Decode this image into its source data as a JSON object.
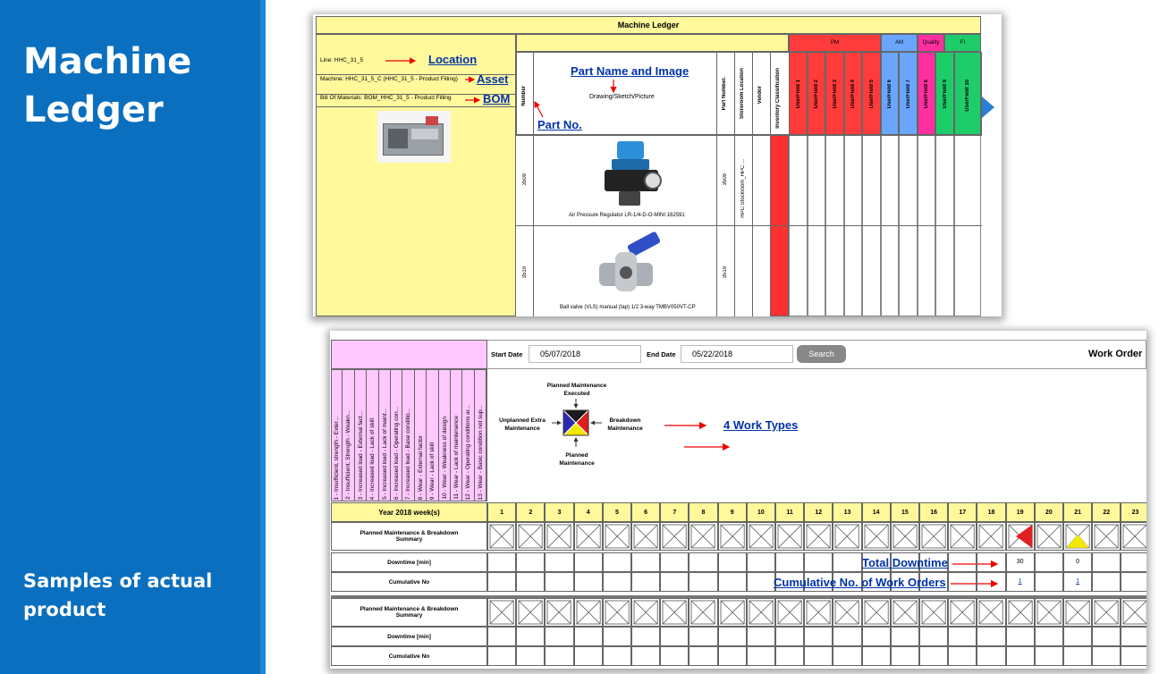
{
  "slide": {
    "title": "Machine Ledger",
    "subtitle": "Samples of actual product"
  },
  "ledger": {
    "title": "Machine Ledger",
    "line": "Line: HHC_31_5",
    "machine": "Machine: HHC_31_5_C (HHC_31_5 - Product Filling)",
    "bom": "Bill Of Materials: BOM_HHC_31_5 - Product Filling",
    "callouts": {
      "location": "Location",
      "asset": "Asset",
      "bom": "BOM",
      "part_name": "Part Name and Image",
      "part_no": "Part No."
    },
    "headers": {
      "number": "Number",
      "drawing": "Drawing/Sketch/Picture",
      "part_number": "Part Number.",
      "storeroom": "Storeroom Location",
      "vendor": "Vendor",
      "inventory": "Inventory Classification"
    },
    "groups": [
      {
        "label": "PM",
        "color": "#ff3b3b"
      },
      {
        "label": "AM",
        "color": "#6aa6ff"
      },
      {
        "label": "Quality",
        "color": "#ff2fa0"
      },
      {
        "label": "FI",
        "color": "#1fcc6a"
      }
    ],
    "userfields": [
      "UserField 1",
      "UserField 2",
      "UserField 3",
      "UserField 4",
      "UserField 5",
      "UserField 6",
      "UserField 7",
      "UserField 8",
      "UserField 9",
      "UserField 10"
    ],
    "rows": [
      {
        "number": "3509",
        "caption": "Air Pressure Regulator LR-1/4-D-O-MINI 162591",
        "part_number": "3509",
        "storeroom": "HPC Stockroom_HPC ..."
      },
      {
        "number": "3519",
        "caption": "Ball valve (VLS) manual (tap) 1/2 3-way TMBV050VT-CP",
        "part_number": "3519",
        "storeroom": ""
      }
    ]
  },
  "workorder": {
    "start_label": "Start Date",
    "start_value": "05/07/2018",
    "end_label": "End Date",
    "end_value": "05/22/2018",
    "search_label": "Search",
    "title": "Work Order",
    "causes": [
      "1 - Insufficient, strength - Exter...",
      "2 - Insufficient, Strength - Weakn...",
      "3 - Increased load - External fact...",
      "4 - Increased load - Lack of skill",
      "5 - Increased load - Lack of maint...",
      "6 - Increased load - Operating con...",
      "7 - Increased load - Base conditio...",
      "8 - Wear - External factor",
      "9 - Wear - Lack of skill",
      "10 - Wear - Weakness of design",
      "11 - Wear - Lack of maintenance",
      "12 - Wear - Operating conditions ar...",
      "13 - Wear - Basic condition not sup..."
    ],
    "types": {
      "top": "Planned Maintenance Executed",
      "left": "Unplanned Extra Maintenance",
      "right": "Breakdown Maintenance",
      "bottom": "Planned Maintenance",
      "colors": {
        "top": "#1a1a1a",
        "left": "#2a2ab0",
        "right": "#e02020",
        "bottom": "#f5e800"
      }
    },
    "callouts": {
      "types": "4 Work Types",
      "downtime": "Total Downtime",
      "cumulative": "Cumulative No. of Work Orders"
    },
    "week_label": "Year 2018 week(s)",
    "weeks": [
      "1",
      "2",
      "3",
      "4",
      "5",
      "6",
      "7",
      "8",
      "9",
      "10",
      "11",
      "12",
      "13",
      "14",
      "15",
      "16",
      "17",
      "18",
      "19",
      "20",
      "21",
      "22",
      "23"
    ],
    "summary_label": "Planned Maintenance & Breakdown Summary",
    "downtime_label": "Downtime [min]",
    "cumulative_label": "Cumulative No",
    "downtime_values": {
      "19": "30",
      "21": "0"
    },
    "cumulative_values": {
      "19": "1",
      "21": "1"
    }
  }
}
